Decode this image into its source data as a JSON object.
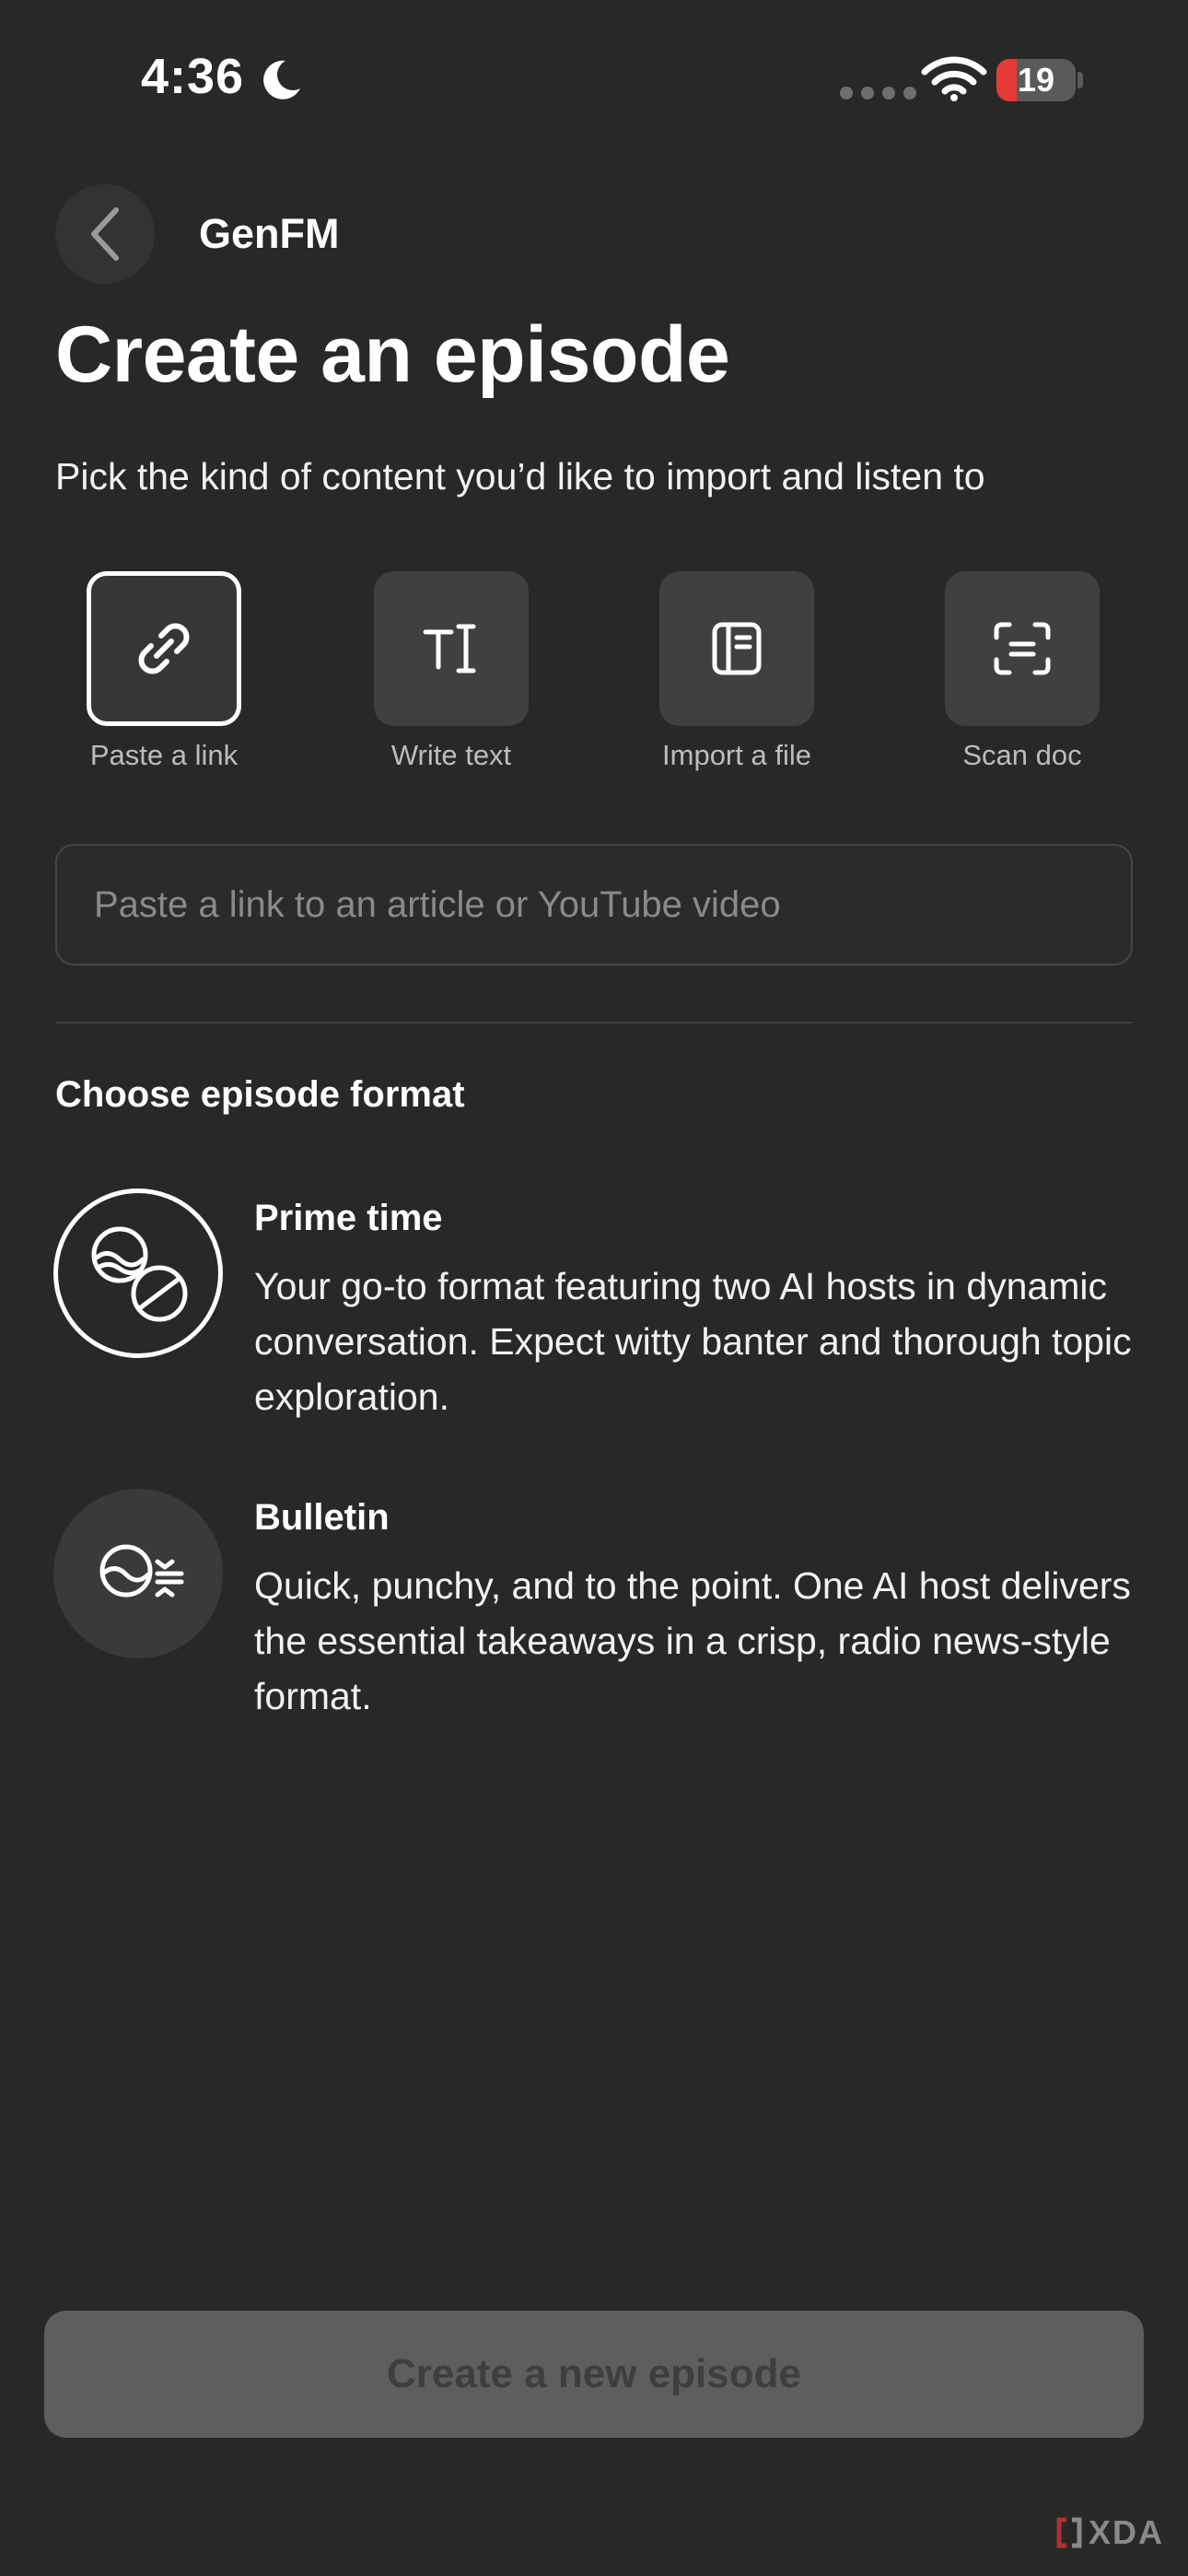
{
  "status_bar": {
    "time": "4:36",
    "battery": "19",
    "battery_color": "#e53935",
    "icons": [
      "moon-icon",
      "signal-dots-icon",
      "wifi-icon",
      "battery-icon"
    ]
  },
  "header": {
    "back_icon": "chevron-left-icon",
    "app_name": "GenFM",
    "title": "Create an episode",
    "subtitle": "Pick the kind of content you’d like to import and listen to"
  },
  "content_types": [
    {
      "label": "Paste a link",
      "icon": "link-icon",
      "selected": true
    },
    {
      "label": "Write text",
      "icon": "text-cursor-icon",
      "selected": false
    },
    {
      "label": "Import a file",
      "icon": "file-icon",
      "selected": false
    },
    {
      "label": "Scan doc",
      "icon": "scan-icon",
      "selected": false
    }
  ],
  "link_input": {
    "value": "",
    "placeholder": "Paste a link to an article or YouTube video"
  },
  "formats": {
    "section_title": "Choose episode format",
    "items": [
      {
        "title": "Prime time",
        "description": "Your go-to format featuring two AI hosts in dynamic conversation. Expect witty banter and thorough topic exploration.",
        "icon": "two-hosts-icon",
        "selected": true
      },
      {
        "title": "Bulletin",
        "description": "Quick, punchy, and to the point. One AI host delivers the essential takeaways in a crisp, radio news-style format.",
        "icon": "single-host-icon",
        "selected": false
      }
    ]
  },
  "primary_action": {
    "label": "Create a new episode",
    "enabled": false
  },
  "watermark": {
    "text": "XDA"
  }
}
